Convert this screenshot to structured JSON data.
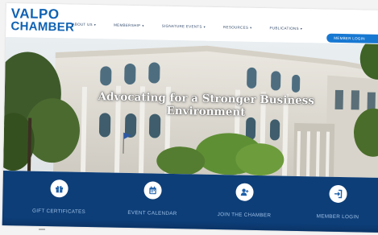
{
  "logo": {
    "line1": "VALPO",
    "line2": "CHAMBER"
  },
  "nav": {
    "items": [
      {
        "label": "ABOUT US"
      },
      {
        "label": "MEMBERSHIP"
      },
      {
        "label": "SIGNATURE EVENTS"
      },
      {
        "label": "RESOURCES"
      },
      {
        "label": "PUBLICATIONS"
      }
    ],
    "member_button": "MEMBER LOGIN"
  },
  "hero": {
    "headline": "Advocating for a Stronger Business Environment"
  },
  "quick_links": [
    {
      "label": "GIFT CERTIFICATES",
      "icon": "gift-icon"
    },
    {
      "label": "EVENT CALENDAR",
      "icon": "calendar-icon"
    },
    {
      "label": "JOIN THE CHAMBER",
      "icon": "add-user-icon"
    },
    {
      "label": "MEMBER LOGIN",
      "icon": "login-icon"
    }
  ],
  "colors": {
    "brand_blue": "#0f62b3",
    "button_blue": "#1778d2",
    "band_navy": "#0d3e78"
  }
}
